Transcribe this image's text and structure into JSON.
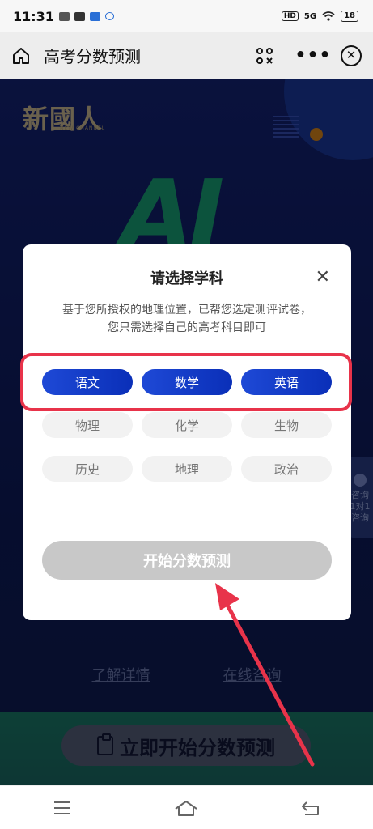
{
  "status_bar": {
    "time": "11:31",
    "hd_label": "HD",
    "signal_label": "5G",
    "battery": "18"
  },
  "nav": {
    "title": "高考分数预测",
    "more_label": "•••",
    "close_label": "✕"
  },
  "background": {
    "brand": "新國人",
    "brand_sub": "NEW CHANNEL",
    "hero_text": "AI",
    "side_tab_lines": [
      "咨询",
      "1对1",
      "咨询"
    ],
    "link_details": "了解详情",
    "link_consult": "在线咨询",
    "cta_label": "立即开始分数预测"
  },
  "modal": {
    "title": "请选择学科",
    "close_label": "✕",
    "description_line1": "基于您所授权的地理位置，已帮您选定测评试卷，",
    "description_line2": "您只需选择自己的高考科目即可",
    "required_subjects": [
      "语文",
      "数学",
      "英语"
    ],
    "optional_row1": [
      "物理",
      "化学",
      "生物"
    ],
    "optional_row2": [
      "历史",
      "地理",
      "政治"
    ],
    "start_button": "开始分数预测"
  },
  "colors": {
    "selected_subject": "#1e49d6",
    "highlight": "#e8334a",
    "disabled_button": "#c8c8c8"
  }
}
